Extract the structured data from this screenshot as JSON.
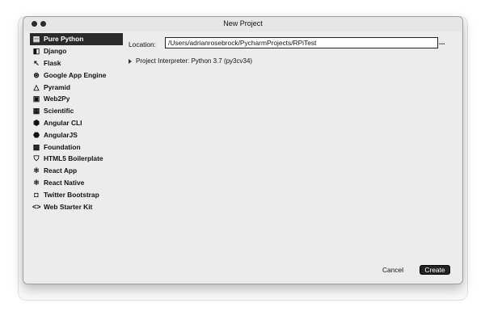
{
  "window": {
    "title": "New Project"
  },
  "sidebar": {
    "items": [
      {
        "label": "Pure Python",
        "icon": "python-file-icon",
        "glyph": "▤",
        "selected": true
      },
      {
        "label": "Django",
        "icon": "django-icon",
        "glyph": "◧",
        "selected": false
      },
      {
        "label": "Flask",
        "icon": "flask-icon",
        "glyph": "↖",
        "selected": false
      },
      {
        "label": "Google App Engine",
        "icon": "app-engine-icon",
        "glyph": "⊛",
        "selected": false
      },
      {
        "label": "Pyramid",
        "icon": "pyramid-icon",
        "glyph": "△",
        "selected": false
      },
      {
        "label": "Web2Py",
        "icon": "web2py-icon",
        "glyph": "▣",
        "selected": false
      },
      {
        "label": "Scientific",
        "icon": "scientific-icon",
        "glyph": "▦",
        "selected": false
      },
      {
        "label": "Angular CLI",
        "icon": "angular-icon",
        "glyph": "⬢",
        "selected": false
      },
      {
        "label": "AngularJS",
        "icon": "angularjs-icon",
        "glyph": "⬣",
        "selected": false
      },
      {
        "label": "Foundation",
        "icon": "foundation-icon",
        "glyph": "▩",
        "selected": false
      },
      {
        "label": "HTML5 Boilerplate",
        "icon": "html5-icon",
        "glyph": "⛉",
        "selected": false
      },
      {
        "label": "React App",
        "icon": "react-icon",
        "glyph": "⚛",
        "selected": false
      },
      {
        "label": "React Native",
        "icon": "react-native-icon",
        "glyph": "⚛",
        "selected": false
      },
      {
        "label": "Twitter Bootstrap",
        "icon": "bootstrap-icon",
        "glyph": "◘",
        "selected": false
      },
      {
        "label": "Web Starter Kit",
        "icon": "web-starter-kit-icon",
        "glyph": "<>",
        "selected": false
      }
    ]
  },
  "location": {
    "label": "Location:",
    "value": "/Users/adrianrosebrock/PycharmProjects/RPiTest",
    "browse_label": "..."
  },
  "interpreter": {
    "label": "Project Interpreter: Python 3.7 (py3cv34)"
  },
  "buttons": {
    "cancel": "Cancel",
    "create": "Create"
  }
}
